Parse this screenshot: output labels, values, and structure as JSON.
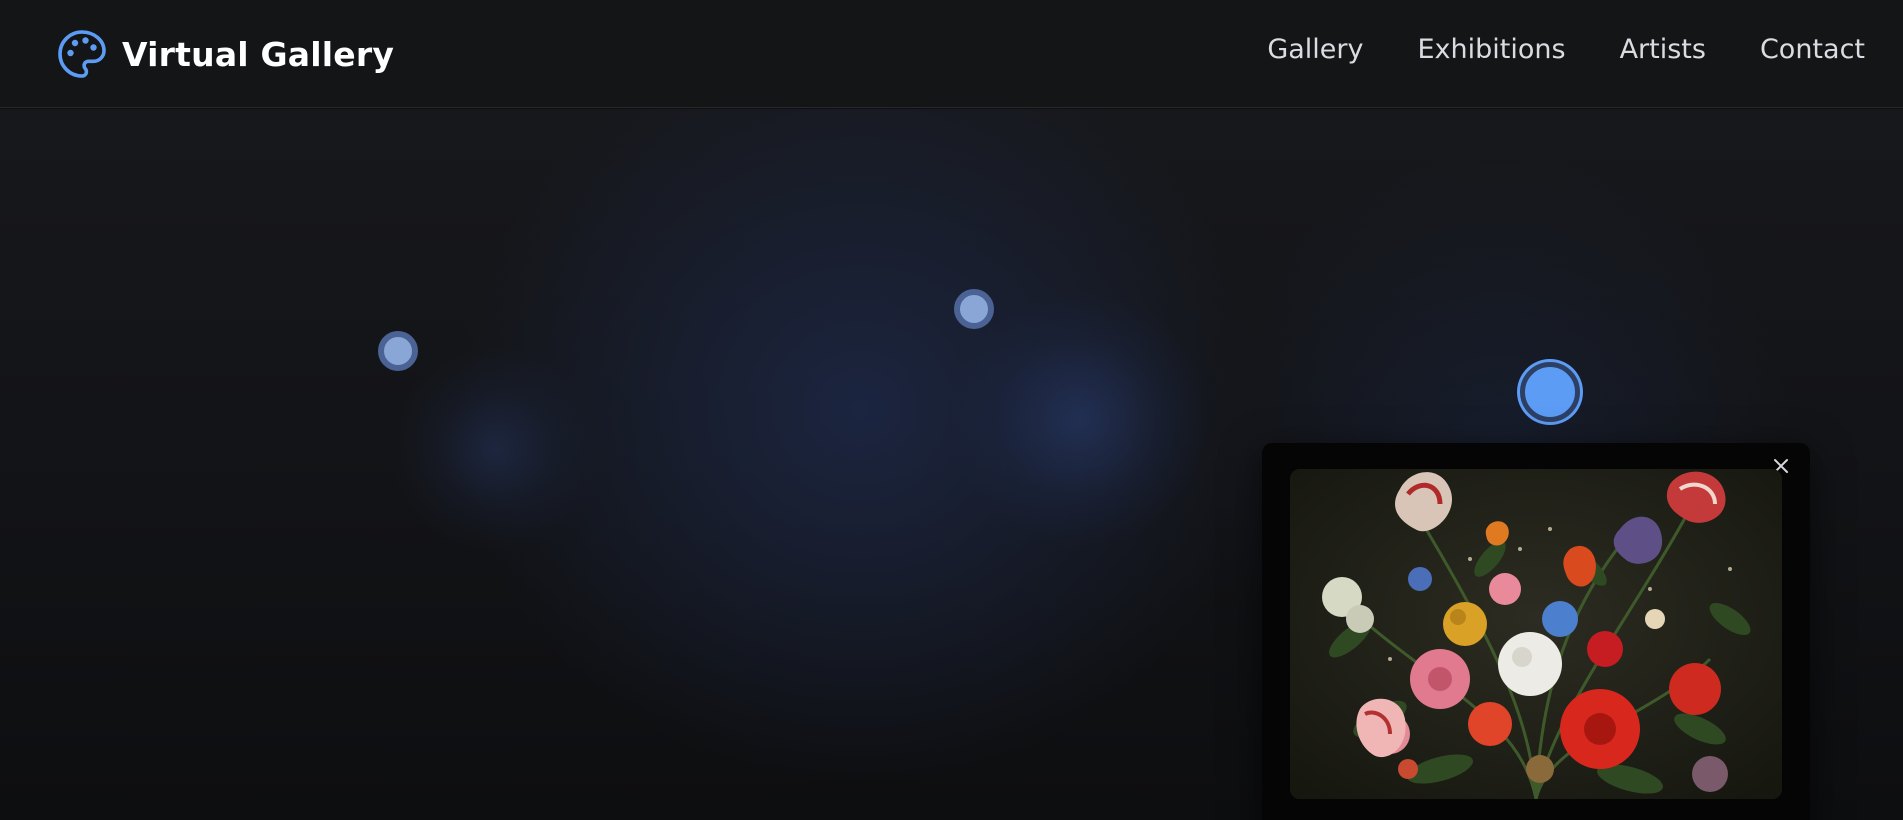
{
  "header": {
    "logo_icon": "palette-icon",
    "title": "Virtual Gallery",
    "accent_color": "#5c9cf5"
  },
  "nav": {
    "items": [
      {
        "label": "Gallery"
      },
      {
        "label": "Exhibitions"
      },
      {
        "label": "Artists"
      },
      {
        "label": "Contact"
      }
    ]
  },
  "stage": {
    "hotspots": [
      {
        "name": "artwork-hotspot-1",
        "state": "inactive"
      },
      {
        "name": "artwork-hotspot-2",
        "state": "inactive"
      },
      {
        "name": "artwork-hotspot-3",
        "state": "active"
      }
    ]
  },
  "popup": {
    "close_icon": "close-icon",
    "artwork_image": "still-life-flowers-painting"
  }
}
